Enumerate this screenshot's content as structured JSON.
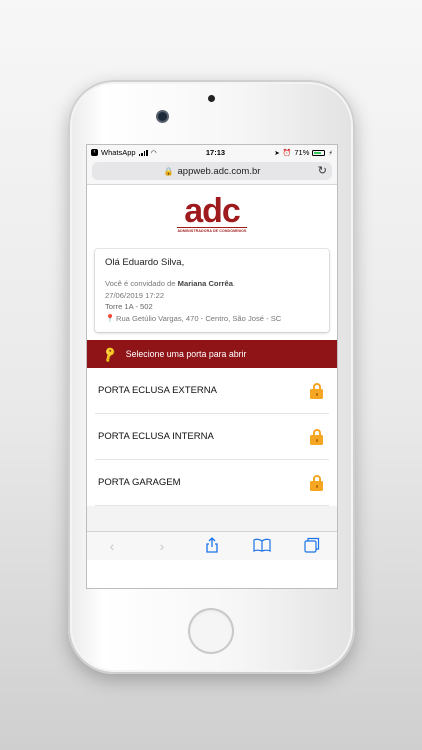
{
  "status_bar": {
    "back_app": "WhatsApp",
    "time": "17:13",
    "battery": "71%",
    "battery_level": 0.71
  },
  "browser": {
    "url": "appweb.adc.com.br"
  },
  "logo": {
    "text": "adc",
    "subtitle": "ADMINISTRADORA DE CONDOMÍNIOS",
    "color": "#9e1a1c"
  },
  "invite_card": {
    "greeting": "Olá Eduardo Silva,",
    "invited_prefix": "Você é convidado de",
    "host_name": "Mariana Corrêa",
    "host_suffix": ".",
    "datetime": "27/06/2019 17:22",
    "unit": "Torre 1A - 502",
    "address": "Rua Getúlio Vargas, 470 - Centro, São José - SC"
  },
  "banner": {
    "text": "Selecione uma porta para abrir",
    "color": "#8f1417"
  },
  "doors": [
    {
      "label": "PORTA ECLUSA EXTERNA"
    },
    {
      "label": "PORTA ECLUSA INTERNA"
    },
    {
      "label": "PORTA GARAGEM"
    }
  ],
  "toolbar": {
    "icons": [
      "back-icon",
      "forward-icon",
      "share-icon",
      "bookmarks-icon",
      "tabs-icon"
    ]
  }
}
